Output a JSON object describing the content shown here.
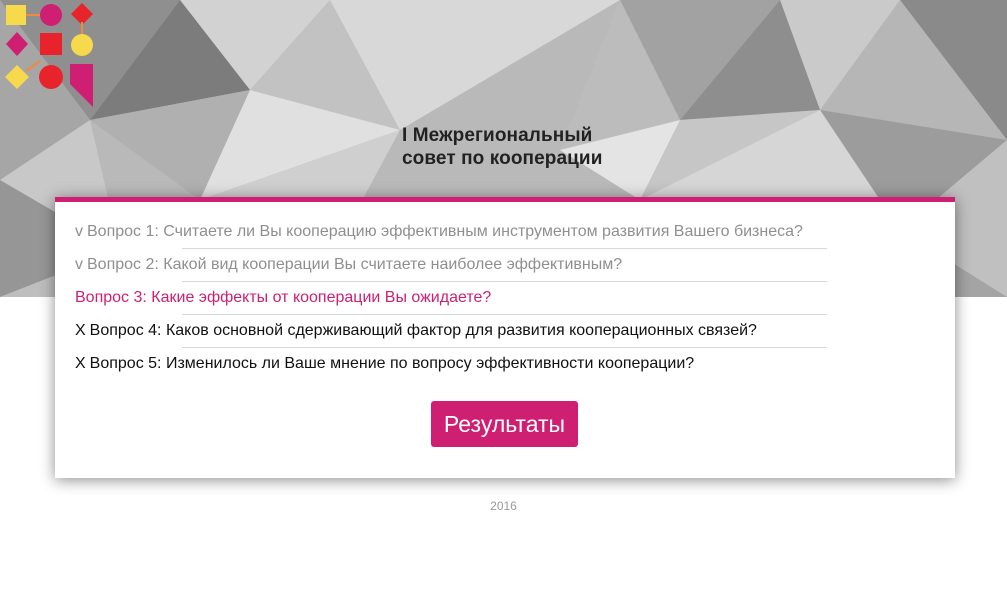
{
  "brand": {
    "title_line1": "I Межрегиональный",
    "title_line2": "совет по кооперации",
    "colors": {
      "magenta": "#cf1f72",
      "red": "#e8232b",
      "yellow": "#f7d94c",
      "orange": "#f08a3c"
    }
  },
  "questions": [
    {
      "prefix": "v",
      "label": "Вопрос 1:",
      "text": "Считаете ли Вы кооперацию эффективным инструментом развития Вашего бизнеса?",
      "state": "done"
    },
    {
      "prefix": "v",
      "label": "Вопрос 2:",
      "text": "Какой вид кооперации Вы считаете наиболее эффективным?",
      "state": "done"
    },
    {
      "prefix": "",
      "label": "Вопрос 3:",
      "text": "Какие эффекты от кооперации Вы ожидаете?",
      "state": "active"
    },
    {
      "prefix": "X",
      "label": "Вопрос 4:",
      "text": "Каков основной сдерживающий фактор для развития кооперационных связей?",
      "state": "todo"
    },
    {
      "prefix": "X",
      "label": "Вопрос 5:",
      "text": "Изменилось ли Ваше мнение по вопросу эффективности кооперации?",
      "state": "todo"
    }
  ],
  "results_button": "Результаты",
  "footer": {
    "year": "2016"
  },
  "theme": {
    "accent": "#cf1f72",
    "hero_background": "#b9b9b9"
  }
}
